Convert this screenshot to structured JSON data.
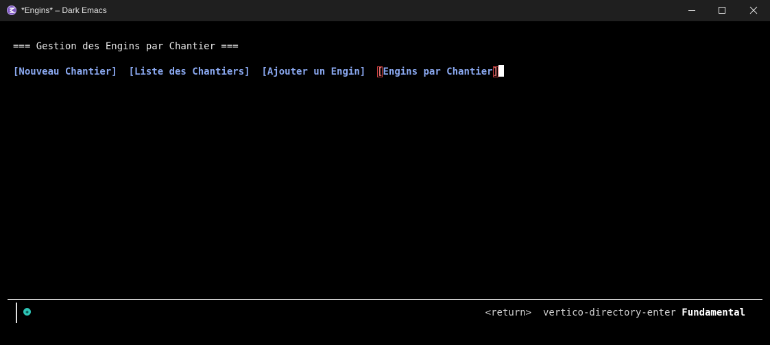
{
  "window": {
    "title": "*Engins* – Dark Emacs",
    "controls": [
      "minimize",
      "maximize",
      "close"
    ]
  },
  "buffer": {
    "heading": "=== Gestion des Engins par Chantier ===",
    "buttons": [
      {
        "label": "[Nouveau Chantier]"
      },
      {
        "label": "[Liste des Chantiers]"
      },
      {
        "label": "[Ajouter un Engin]"
      },
      {
        "label": "Engins par Chantier",
        "open_bracket": "[",
        "close_bracket": "]",
        "active": true
      }
    ]
  },
  "modeline": {
    "status_indicator_glyph": "◈",
    "key_hint": "<return>",
    "command": "vertico-directory-enter",
    "major_mode": "Fundamental"
  },
  "colors": {
    "background": "#000000",
    "titlebar": "#1f1f1f",
    "link": "#8aa8f0",
    "active_bracket": "#e07070",
    "indicator": "#2ec4b6"
  }
}
